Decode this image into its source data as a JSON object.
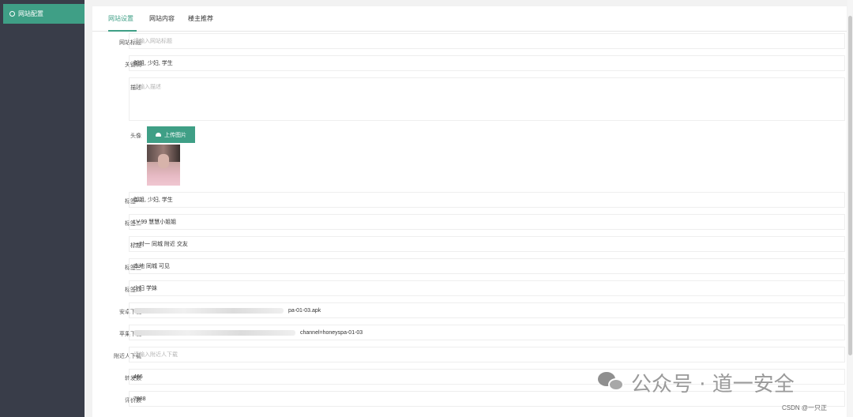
{
  "sidebar": {
    "active_item": "网站配置"
  },
  "tabs": [
    "网站设置",
    "网站内容",
    "楼主推荐"
  ],
  "form": {
    "site_title": {
      "label": "网站标题",
      "placeholder": "请输入网站标题"
    },
    "keywords": {
      "label": "关键词",
      "value": "御姐, 少妇, 学生"
    },
    "description": {
      "label": "描述",
      "placeholder": "请输入描述"
    },
    "avatar": {
      "label": "头像",
      "upload_label": "上传图片"
    },
    "tag1": {
      "label": "标签一",
      "value": "御姐, 少妇, 学生"
    },
    "tag2": {
      "label": "标签二",
      "value": "LV.99 慧慧小姐姐"
    },
    "tag_title": {
      "label": "标题",
      "value": "一对一 同城 附近 交友"
    },
    "tag3": {
      "label": "标签三",
      "value": "本地 同城 可见"
    },
    "tag4": {
      "label": "标签四",
      "value": "少妇 学妹"
    },
    "android_download": {
      "label": "安卓下载",
      "value_suffix": "pa-01-03.apk"
    },
    "ios_download": {
      "label": "苹果下载",
      "value_suffix": "channel=honeyspa-01-03"
    },
    "nearby_download": {
      "label": "附近人下载",
      "placeholder": "请输入附近人下载"
    },
    "forward_count": {
      "label": "转发数",
      "value": "466"
    },
    "review_count": {
      "label": "评价数",
      "value": "7988"
    }
  },
  "watermark": {
    "text": "公众号 · 道一安全",
    "icon": "wechat-icon"
  },
  "credit": "CSDN @一只正",
  "colors": {
    "accent": "#3f9f86",
    "sidebar_bg": "#393d49"
  }
}
